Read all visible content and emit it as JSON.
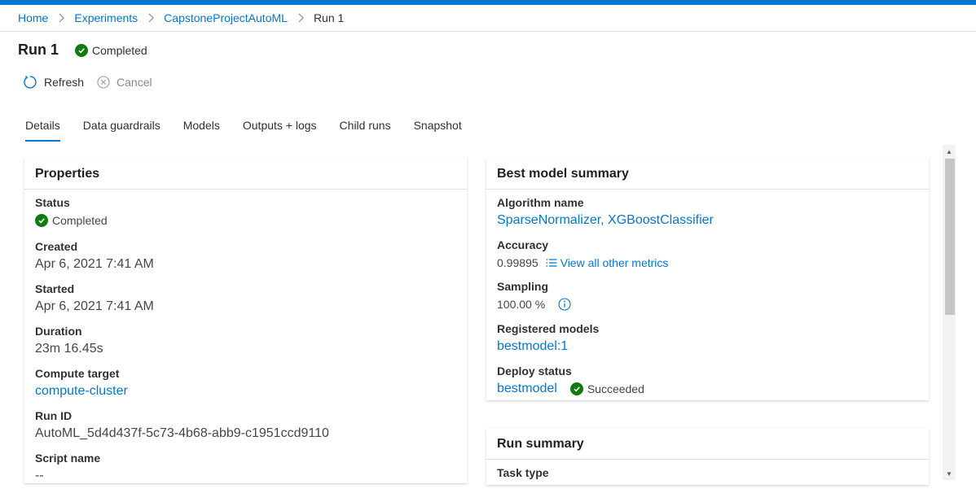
{
  "breadcrumb": {
    "items": [
      "Home",
      "Experiments",
      "CapstoneProjectAutoML"
    ],
    "current": "Run 1"
  },
  "header": {
    "title": "Run 1",
    "status": "Completed"
  },
  "commands": {
    "refresh": "Refresh",
    "cancel": "Cancel"
  },
  "tabs": [
    "Details",
    "Data guardrails",
    "Models",
    "Outputs + logs",
    "Child runs",
    "Snapshot"
  ],
  "properties": {
    "title": "Properties",
    "status_label": "Status",
    "status_value": "Completed",
    "created_label": "Created",
    "created_value": "Apr 6, 2021 7:41 AM",
    "started_label": "Started",
    "started_value": "Apr 6, 2021 7:41 AM",
    "duration_label": "Duration",
    "duration_value": "23m 16.45s",
    "compute_label": "Compute target",
    "compute_value": "compute-cluster",
    "runid_label": "Run ID",
    "runid_value": "AutoML_5d4d437f-5c73-4b68-abb9-c1951ccd9110",
    "script_label": "Script name",
    "script_value": "--"
  },
  "best_model": {
    "title": "Best model summary",
    "algorithm_label": "Algorithm name",
    "algorithm_value": "SparseNormalizer, XGBoostClassifier",
    "accuracy_label": "Accuracy",
    "accuracy_value": "0.99895",
    "metrics_link": "View all other metrics",
    "sampling_label": "Sampling",
    "sampling_value": "100.00 %",
    "registered_label": "Registered models",
    "registered_value": "bestmodel:1",
    "deploy_label": "Deploy status",
    "deploy_value": "bestmodel",
    "deploy_state": "Succeeded"
  },
  "run_summary": {
    "title": "Run summary",
    "task_label": "Task type"
  },
  "colors": {
    "accent": "#0078d4",
    "success": "#107c10"
  }
}
